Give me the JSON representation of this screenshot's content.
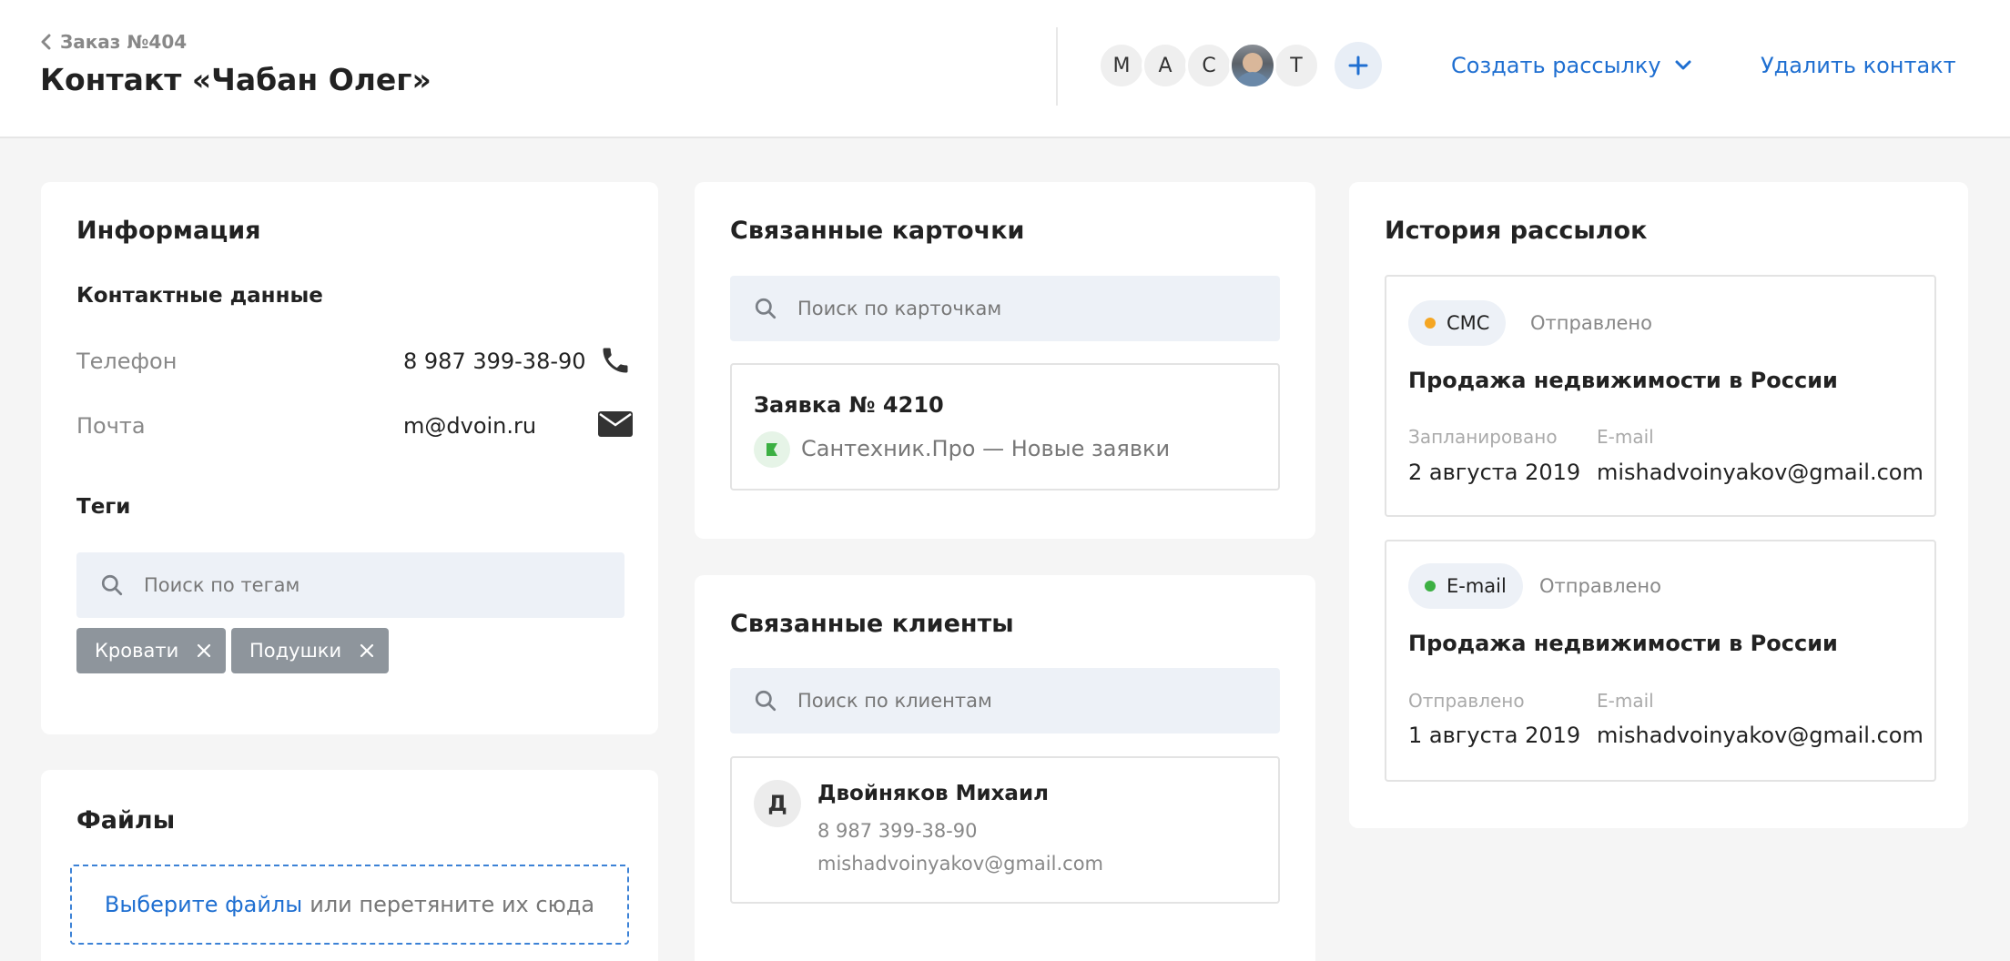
{
  "header": {
    "back_label": "Заказ №404",
    "title": "Контакт «Чабан Олег»",
    "avatars": [
      "М",
      "А",
      "С",
      "",
      "Т"
    ],
    "create_mailing_label": "Создать рассылку",
    "delete_contact_label": "Удалить контакт",
    "accent_color": "#1f6fd1"
  },
  "info": {
    "title": "Информация",
    "contacts_title": "Контактные данные",
    "phone_label": "Телефон",
    "phone_value": "8 987 399-38-90",
    "email_label": "Почта",
    "email_value": "m@dvoin.ru",
    "tags_title": "Теги",
    "tags_search_placeholder": "Поиск по тегам",
    "tags": [
      "Кровати",
      "Подушки"
    ]
  },
  "files": {
    "title": "Файлы",
    "choose_link": "Выберите файлы",
    "drop_text": "или перетяните их сюда"
  },
  "related_cards": {
    "title": "Связанные карточки",
    "search_placeholder": "Поиск по карточкам",
    "card_title": "Заявка № 4210",
    "card_pipeline": "Сантехник.Про — Новые заявки"
  },
  "related_clients": {
    "title": "Связанные клиенты",
    "search_placeholder": "Поиск по клиентам",
    "client_initial": "Д",
    "client_name": "Двойняков Михаил",
    "client_phone": "8 987 399-38-90",
    "client_email": "mishadvoinyakov@gmail.com"
  },
  "history": {
    "title": "История рассылок",
    "items": [
      {
        "channel": "СМС",
        "channel_color": "#f5a623",
        "status": "Отправлено",
        "subject": "Продажа недвижимости в России",
        "date_label": "Запланировано",
        "date_value": "2 августа 2019",
        "email_label": "E-mail",
        "email_value": "mishadvoinyakov@gmail.com"
      },
      {
        "channel": "E-mail",
        "channel_color": "#3cb043",
        "status": "Отправлено",
        "subject": "Продажа недвижимости в России",
        "date_label": "Отправлено",
        "date_value": "1 августа 2019",
        "email_label": "E-mail",
        "email_value": "mishadvoinyakov@gmail.com"
      }
    ]
  }
}
